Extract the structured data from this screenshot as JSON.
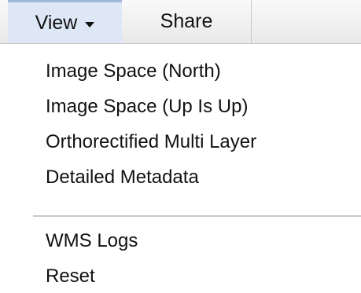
{
  "menubar": {
    "view_label": "View",
    "share_label": "Share"
  },
  "dropdown": {
    "group1": [
      "Image Space (North)",
      "Image Space (Up Is Up)",
      "Orthorectified Multi Layer",
      "Detailed Metadata"
    ],
    "group2": [
      "WMS Logs",
      "Reset"
    ]
  },
  "colors": {
    "active_tab_bg": "#dde7f6",
    "active_tab_border": "#9fb6d9",
    "separator": "#c9c9c9"
  },
  "icons": {
    "view_dropdown": "caret-down-icon"
  }
}
